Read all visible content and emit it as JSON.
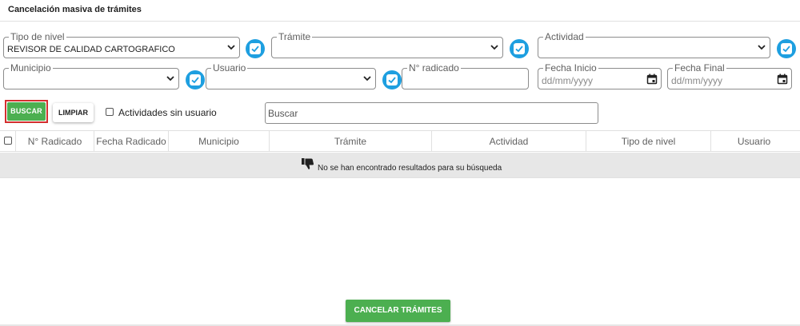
{
  "page": {
    "title": "Cancelación masiva de trámites"
  },
  "filters": {
    "tipo_nivel": {
      "label": "Tipo de nivel",
      "value": "REVISOR DE CALIDAD CARTOGRAFICO"
    },
    "tramite": {
      "label": "Trámite",
      "value": ""
    },
    "actividad": {
      "label": "Actividad",
      "value": ""
    },
    "municipio": {
      "label": "Municipio",
      "value": ""
    },
    "usuario": {
      "label": "Usuario",
      "value": ""
    },
    "radicado": {
      "label": "N° radicado",
      "value": ""
    },
    "fecha_inicio": {
      "label": "Fecha Inicio",
      "placeholder": "dd/mm/yyyy"
    },
    "fecha_final": {
      "label": "Fecha Final",
      "placeholder": "dd/mm/yyyy"
    }
  },
  "actions": {
    "buscar_label": "BUSCAR",
    "limpiar_label": "LIMPIAR",
    "sin_usuario_label": "Actividades sin usuario",
    "search_placeholder": "Buscar",
    "cancel_label": "CANCELAR TRÁMITES"
  },
  "table": {
    "columns": [
      "N° Radicado",
      "Fecha Radicado",
      "Municipio",
      "Trámite",
      "Actividad",
      "Tipo de nivel",
      "Usuario"
    ],
    "empty_message": "No se han encontrado resultados para su búsqueda"
  },
  "colors": {
    "primary_green": "#4caf50",
    "accent_blue": "#1e9fe0",
    "highlight_red": "#d32f2f"
  },
  "icons": {
    "select": "chevron-down-icon",
    "date": "calendar-icon",
    "toggle": "checkbox-check-icon",
    "empty": "thumbs-down-icon"
  }
}
